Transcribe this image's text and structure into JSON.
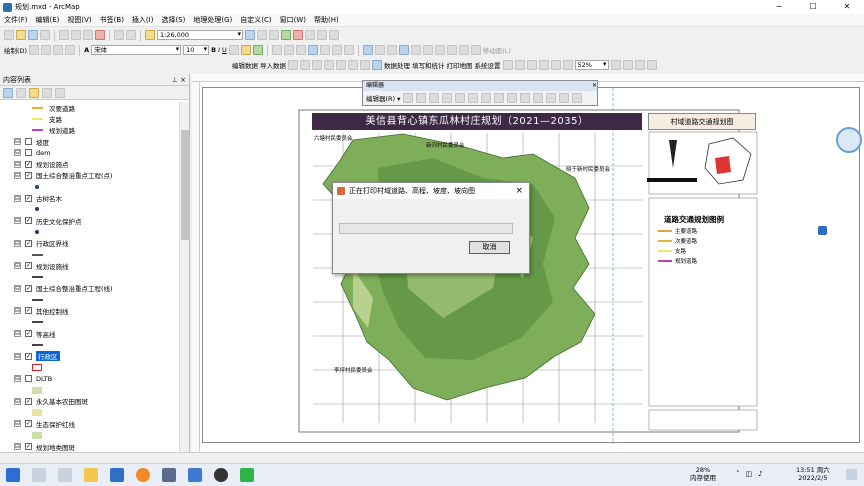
{
  "window": {
    "title": "规划.mxd - ArcMap"
  },
  "menu": [
    "文件(F)",
    "编辑(E)",
    "视图(V)",
    "书签(B)",
    "插入(I)",
    "选择(S)",
    "地理处理(G)",
    "自定义(C)",
    "窗口(W)",
    "帮助(H)"
  ],
  "toolbar": {
    "scale": "1:26,000",
    "draw_label": "绘制(D)",
    "font_name": "宋体",
    "font_size": "10",
    "editor_menu": "编辑器(R)",
    "layout_zoom": "52%",
    "right_menus": [
      "编辑数据",
      "导入数据",
      "数据处理",
      "填写和统计",
      "打印地图",
      "系统设置"
    ],
    "move_label": "移动面(L)"
  },
  "toc": {
    "title": "内容列表",
    "pin": "⊥ ×",
    "items": [
      {
        "type": "legend",
        "label": "次要道路",
        "color": "#e8b23a",
        "kind": "line"
      },
      {
        "type": "legend",
        "label": "支路",
        "color": "#f2e27a",
        "kind": "line"
      },
      {
        "type": "legend",
        "label": "规划道路",
        "color": "#c03fb0",
        "kind": "line"
      },
      {
        "type": "layer",
        "label": "坡度",
        "checked": false
      },
      {
        "type": "layer",
        "label": "dem",
        "checked": false
      },
      {
        "type": "layer",
        "label": "规划设施点",
        "checked": true
      },
      {
        "type": "layer",
        "label": "国土综合整治重点工程(点)",
        "checked": true
      },
      {
        "type": "legend",
        "label": "",
        "color": "#1f3a7a",
        "kind": "point"
      },
      {
        "type": "layer",
        "label": "古树名木",
        "checked": true
      },
      {
        "type": "legend",
        "label": "",
        "color": "#1f3a7a",
        "kind": "point"
      },
      {
        "type": "layer",
        "label": "历史文化保护点",
        "checked": true
      },
      {
        "type": "legend",
        "label": "",
        "color": "#1f3a7a",
        "kind": "point"
      },
      {
        "type": "layer",
        "label": "行政区界线",
        "checked": true
      },
      {
        "type": "legend",
        "label": "",
        "color": "#555",
        "kind": "line"
      },
      {
        "type": "layer",
        "label": "规划设施线",
        "checked": true
      },
      {
        "type": "legend",
        "label": "",
        "color": "#444",
        "kind": "line"
      },
      {
        "type": "layer",
        "label": "国土综合整治重点工程(线)",
        "checked": true
      },
      {
        "type": "legend",
        "label": "",
        "color": "#444",
        "kind": "line"
      },
      {
        "type": "layer",
        "label": "其他控制线",
        "checked": true
      },
      {
        "type": "legend",
        "label": "",
        "color": "#444",
        "kind": "line"
      },
      {
        "type": "layer",
        "label": "等高线",
        "checked": true
      },
      {
        "type": "legend",
        "label": "",
        "color": "#444",
        "kind": "line"
      },
      {
        "type": "layer",
        "label": "行政区",
        "checked": true,
        "selected": true
      },
      {
        "type": "legend",
        "label": "",
        "color": "#e02020",
        "kind": "box"
      },
      {
        "type": "layer",
        "label": "DLTB",
        "checked": false
      },
      {
        "type": "legend",
        "label": "",
        "color": "#d9d9b0",
        "kind": "box"
      },
      {
        "type": "layer",
        "label": "永久基本农田图斑",
        "checked": true
      },
      {
        "type": "legend",
        "label": "",
        "color": "#e6e2a0",
        "kind": "box"
      },
      {
        "type": "layer",
        "label": "生态保护红线",
        "checked": true
      },
      {
        "type": "legend",
        "label": "",
        "color": "#c8e0a8",
        "kind": "box"
      },
      {
        "type": "layer",
        "label": "规划地类图斑",
        "checked": true
      }
    ]
  },
  "editor_window": {
    "title": "编辑器",
    "menu": "编辑器(R) ▾"
  },
  "map": {
    "title": "美信县背心镇东瓜林村庄规划（2021—2035）",
    "side_title": "村域道路交通规划图",
    "village_labels": [
      "六塘村民委员会",
      "新河村民委员会",
      "晓于新村民委员会",
      "李坪村民委员会"
    ],
    "legend_title": "道路交通规划图例",
    "legend": [
      {
        "label": "主要道路",
        "color": "#e8a03a"
      },
      {
        "label": "次要道路",
        "color": "#e8b23a"
      },
      {
        "label": "支路",
        "color": "#f2e27a"
      },
      {
        "label": "规划道路",
        "color": "#c03fb0"
      }
    ]
  },
  "dialog": {
    "title": "正在打印村域道路、高程、坡度、坡向图",
    "close": "×",
    "progress": 0,
    "cancel_label": "取消"
  },
  "taskbar": {
    "cpu": "28%",
    "cpu_label": "内存使用",
    "time": "13:51 周六",
    "date": "2022/2/5"
  }
}
